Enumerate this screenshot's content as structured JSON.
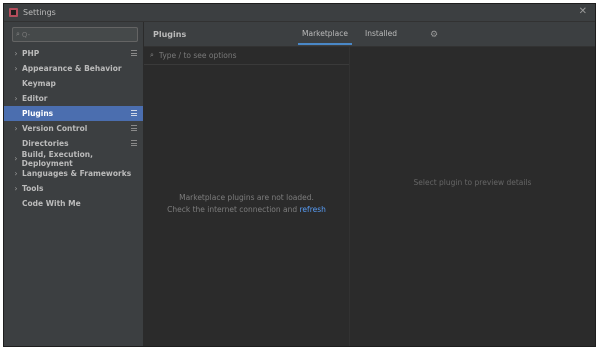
{
  "window": {
    "title": "Settings"
  },
  "sidebar": {
    "search_placeholder": "Q-",
    "items": [
      {
        "label": "PHP",
        "arrow": true,
        "project_icon": true,
        "selected": false
      },
      {
        "label": "Appearance & Behavior",
        "arrow": true,
        "project_icon": false,
        "selected": false
      },
      {
        "label": "Keymap",
        "arrow": false,
        "project_icon": false,
        "selected": false
      },
      {
        "label": "Editor",
        "arrow": true,
        "project_icon": false,
        "selected": false
      },
      {
        "label": "Plugins",
        "arrow": false,
        "project_icon": true,
        "selected": true
      },
      {
        "label": "Version Control",
        "arrow": true,
        "project_icon": true,
        "selected": false
      },
      {
        "label": "Directories",
        "arrow": false,
        "project_icon": true,
        "selected": false
      },
      {
        "label": "Build, Execution, Deployment",
        "arrow": true,
        "project_icon": false,
        "selected": false
      },
      {
        "label": "Languages & Frameworks",
        "arrow": true,
        "project_icon": false,
        "selected": false
      },
      {
        "label": "Tools",
        "arrow": true,
        "project_icon": false,
        "selected": false
      },
      {
        "label": "Code With Me",
        "arrow": false,
        "project_icon": false,
        "selected": false
      }
    ]
  },
  "header": {
    "title": "Plugins",
    "tabs": [
      {
        "label": "Marketplace",
        "active": true
      },
      {
        "label": "Installed",
        "active": false
      }
    ]
  },
  "plugins": {
    "search_placeholder": "Type / to see options",
    "empty_line1": "Marketplace plugins are not loaded.",
    "empty_line2": "Check the internet connection and",
    "refresh_link": "refresh"
  },
  "preview": {
    "placeholder": "Select plugin to preview details"
  },
  "icons": {
    "search": "search-icon",
    "close": "close-icon",
    "gear": "gear-icon",
    "chevron": "chevron-right-icon",
    "project": "project-icon"
  },
  "colors": {
    "background": "#2b2b2b",
    "panel": "#3c3f41",
    "selection": "#4b6eaf",
    "accent": "#4a88c7",
    "link": "#589df6"
  }
}
